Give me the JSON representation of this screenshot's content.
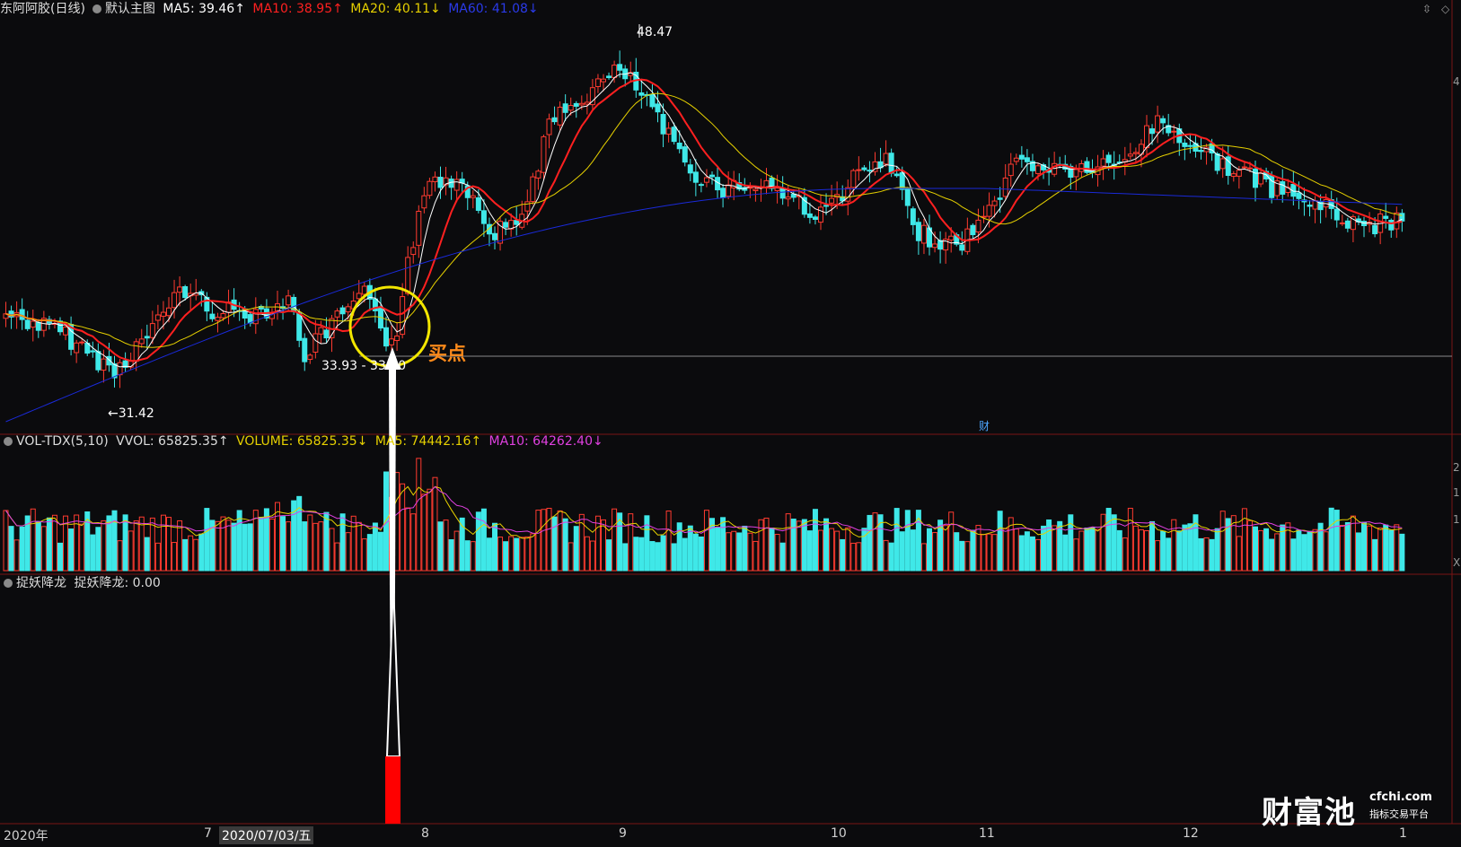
{
  "main_chart": {
    "stock_name": "东阿阿胶(日线)",
    "main_label": "默认主图",
    "ma5": "MA5: 39.46↑",
    "ma10": "MA10: 38.95↑",
    "ma20": "MA20: 40.11↓",
    "ma60": "MA60: 41.08↓",
    "high_label": "48.47",
    "low_label": "←31.42",
    "range_label": "33.93 - 33.70",
    "buy_point_label": "买点",
    "marker_cai": "财",
    "colors": {
      "ma5": "#ffffff",
      "ma10": "#ff2020",
      "ma20": "#e6d000",
      "ma60": "#1a2ad8",
      "up": "#ff3b30",
      "down": "#3fe8e8"
    }
  },
  "volume_panel": {
    "name": "VOL-TDX(5,10)",
    "vvol": "VVOL: 65825.35↑",
    "volume": "VOLUME: 65825.35↓",
    "ma5": "MA5: 74442.16↑",
    "ma10": "MA10: 64262.40↓"
  },
  "indicator_panel": {
    "name": "捉妖降龙",
    "value": "捉妖降龙: 0.00"
  },
  "x_axis": {
    "year": "2020年",
    "months": [
      "7",
      "8",
      "9",
      "10",
      "11",
      "12",
      "1"
    ],
    "cursor_date": "2020/07/03/五"
  },
  "watermark": {
    "brand": "财富池",
    "site": "cfchi.com",
    "tagline": "指标交易平台"
  },
  "right_axis_marks": [
    "4",
    "2",
    "1",
    "1",
    "X"
  ]
}
